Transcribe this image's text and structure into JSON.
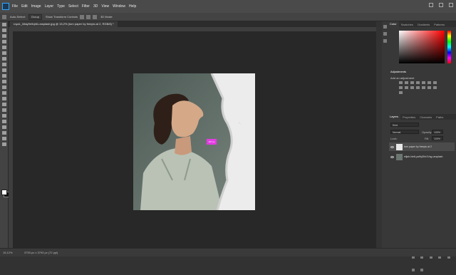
{
  "menubar": {
    "items": [
      "File",
      "Edit",
      "Image",
      "Layer",
      "Type",
      "Select",
      "Filter",
      "3D",
      "View",
      "Window",
      "Help"
    ]
  },
  "options": {
    "auto_select_label": "Auto-Select:",
    "auto_select_value": "Group",
    "transform_label": "Show Transform Controls",
    "mode_label": "3D Mode:"
  },
  "document": {
    "tab_title": "royal-_iMay9n9qh6-unsplash.jpg @ 15,2% (torn paper by freepic.at 2, RGB/8) *"
  },
  "status": {
    "zoom": "15,12%",
    "doc_size": "3793 px x 3793 px (72 ppi)"
  },
  "color_panel": {
    "tabs": [
      "Color",
      "Swatches",
      "Gradients",
      "Patterns"
    ],
    "accent_color": "#ff0000"
  },
  "adjustments": {
    "title": "Adjustments",
    "subtitle": "Add an adjustment"
  },
  "layers_panel": {
    "tabs": [
      "Layers",
      "Properties",
      "Channels",
      "Paths"
    ],
    "kind_label": "Kind",
    "blend_mode": "Normal",
    "opacity_label": "Opacity:",
    "opacity_value": "100%",
    "lock_label": "Lock:",
    "fill_label": "Fill:",
    "fill_value": "100%",
    "layers": [
      {
        "name": "torn paper by freepic.at 2",
        "selected": true
      },
      {
        "name": "elijah-hiett-yw9qZhb1Vsg-unsplash",
        "selected": false
      }
    ]
  },
  "canvas_tag": "107 px",
  "icons": [
    "ps-logo-icon",
    "move-tool-icon",
    "eye-icon",
    "search-icon",
    "hue-slider"
  ]
}
